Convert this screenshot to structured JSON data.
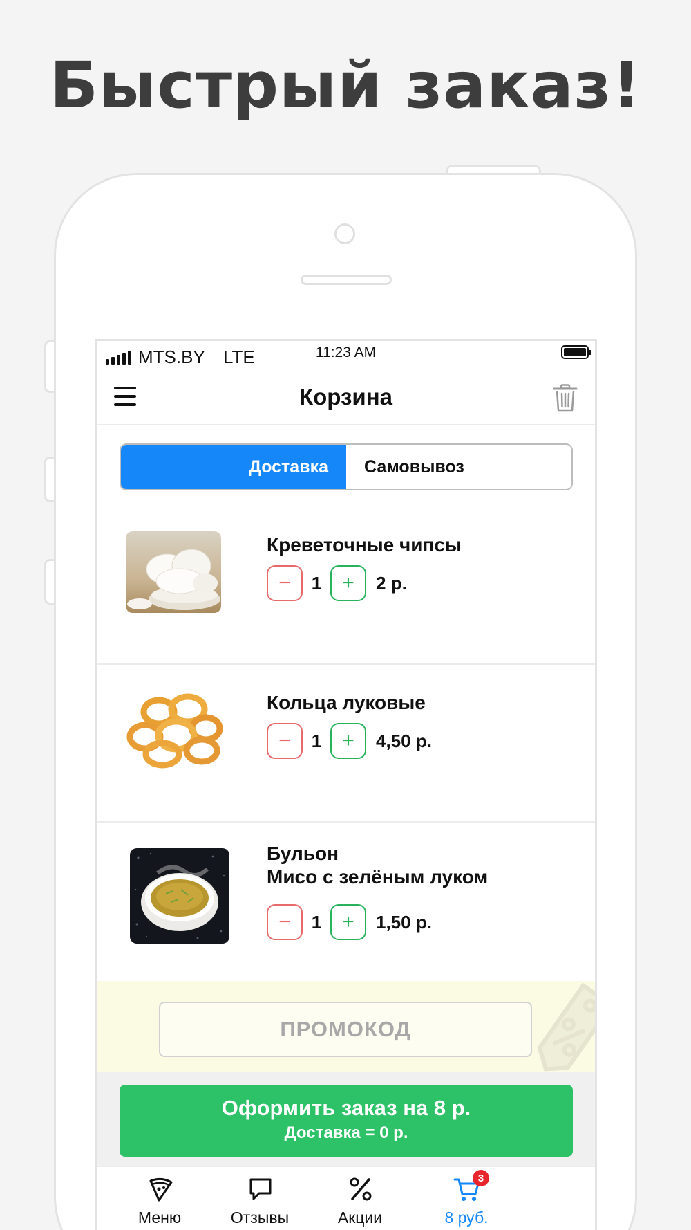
{
  "headline": "Быстрый заказ!",
  "status_bar": {
    "carrier": "MTS.BY",
    "network": "LTE",
    "time": "11:23 AM"
  },
  "nav": {
    "title": "Корзина"
  },
  "delivery_toggle": {
    "options": [
      "Доставка",
      "Самовывоз"
    ],
    "selected": "Доставка"
  },
  "cart_items": [
    {
      "name": "Креветочные чипсы",
      "quantity": "1",
      "price": "2 р."
    },
    {
      "name": "Кольца луковые",
      "quantity": "1",
      "price": "4,50 р."
    },
    {
      "name_line1": "Бульон",
      "name_line2": "Мисо с зелёным луком",
      "quantity": "1",
      "price": "1,50 р."
    }
  ],
  "qty_controls": {
    "minus": "−",
    "plus": "+"
  },
  "promo": {
    "placeholder": "ПРОМОКОД"
  },
  "checkout": {
    "line1": "Оформить заказ на 8 р.",
    "line2": "Доставка = 0 р."
  },
  "tabbar": {
    "items": [
      {
        "label": "Меню",
        "icon": "pizza-slice-icon"
      },
      {
        "label": "Отзывы",
        "icon": "speech-bubble-icon"
      },
      {
        "label": "Акции",
        "icon": "percent-icon"
      },
      {
        "label": "8 руб.",
        "icon": "cart-icon",
        "badge": "3"
      }
    ],
    "active_index": 3
  },
  "colors": {
    "accent_blue": "#1687f9",
    "checkout_green": "#2dc168",
    "minus_red": "#e86a6a",
    "plus_green": "#27b25b",
    "badge_red": "#e8242d",
    "promo_band": "#fbfae3"
  }
}
